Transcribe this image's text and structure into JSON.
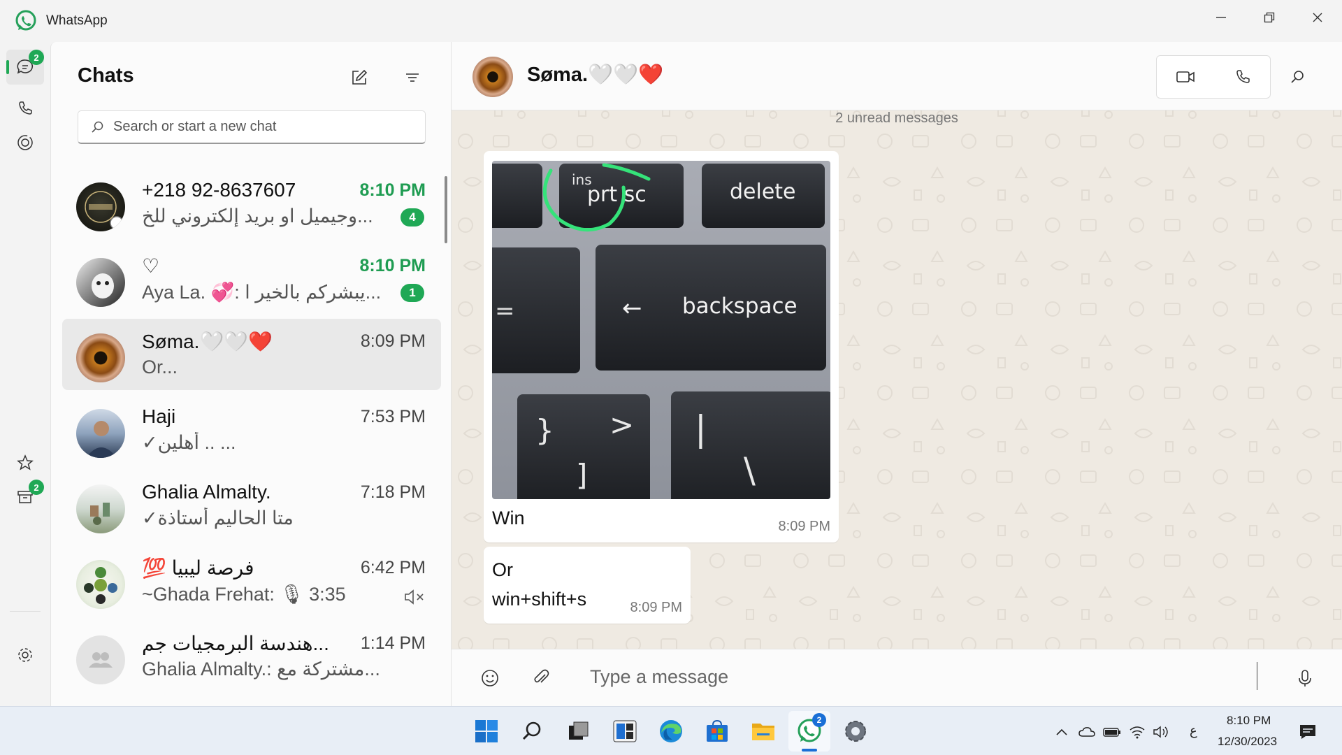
{
  "window": {
    "title": "WhatsApp"
  },
  "rail": {
    "chats_badge": "2",
    "archived_badge": "2"
  },
  "chatlist": {
    "title": "Chats",
    "search_placeholder": "Search or start a new chat",
    "chats": [
      {
        "name": "+218 92-8637607",
        "time": "8:10 PM",
        "preview": "وجيميل او بريد إلكتروني للخ...",
        "unread": "4"
      },
      {
        "name": "♡",
        "time": "8:10 PM",
        "preview": "Aya La. 💞: يبشركم بالخير ا...",
        "unread": "1"
      },
      {
        "name": "Søma.🤍🤍❤️",
        "time": "8:09 PM",
        "preview": "Or...",
        "unread": ""
      },
      {
        "name": "Haji",
        "time": "7:53 PM",
        "preview": "✓أهلين .. ...",
        "unread": ""
      },
      {
        "name": "Ghalia Almalty.",
        "time": "7:18 PM",
        "preview": "✓متا الحاليم أستاذة",
        "unread": ""
      },
      {
        "name": "💯 فرصة ليبيا",
        "time": "6:42 PM",
        "preview": "~Ghada Frehat: 🎙 3:35",
        "unread": ""
      },
      {
        "name": "هندسة البرمجيات جم...",
        "time": "1:14 PM",
        "preview": "Ghalia Almalty.: مشتركة مع...",
        "unread": ""
      }
    ]
  },
  "conversation": {
    "contact_name": "Søma.🤍🤍❤️",
    "unread_divider": "2 unread messages",
    "messages": [
      {
        "caption": "Win",
        "time": "8:09 PM"
      },
      {
        "text": "Or\nwin+shift+s",
        "time": "8:09 PM"
      }
    ],
    "image_keys": {
      "ins": "ins",
      "prtsc": "prt sc",
      "delete": "delete",
      "backspace": "backspace",
      "equals": "=",
      "arrow": "←",
      "brace": "}",
      "bracket": "]",
      "gt": ">",
      "pipe": "|",
      "backslash": "\\"
    },
    "composer_placeholder": "Type a message"
  },
  "taskbar": {
    "whatsapp_badge": "2",
    "lang": "ع",
    "time": "8:10 PM",
    "date": "12/30/2023"
  },
  "colors": {
    "accent": "#1fa855",
    "unread_time": "#1f9c52",
    "chat_background": "#efeae2"
  },
  "icons": [
    "whatsapp-logo-icon",
    "chats-icon",
    "calls-icon",
    "status-icon",
    "starred-icon",
    "archive-icon",
    "settings-icon",
    "new-chat-icon",
    "filter-icon",
    "search-icon",
    "video-call-icon",
    "voice-call-icon",
    "emoji-icon",
    "attach-icon",
    "mic-icon",
    "muted-icon"
  ]
}
